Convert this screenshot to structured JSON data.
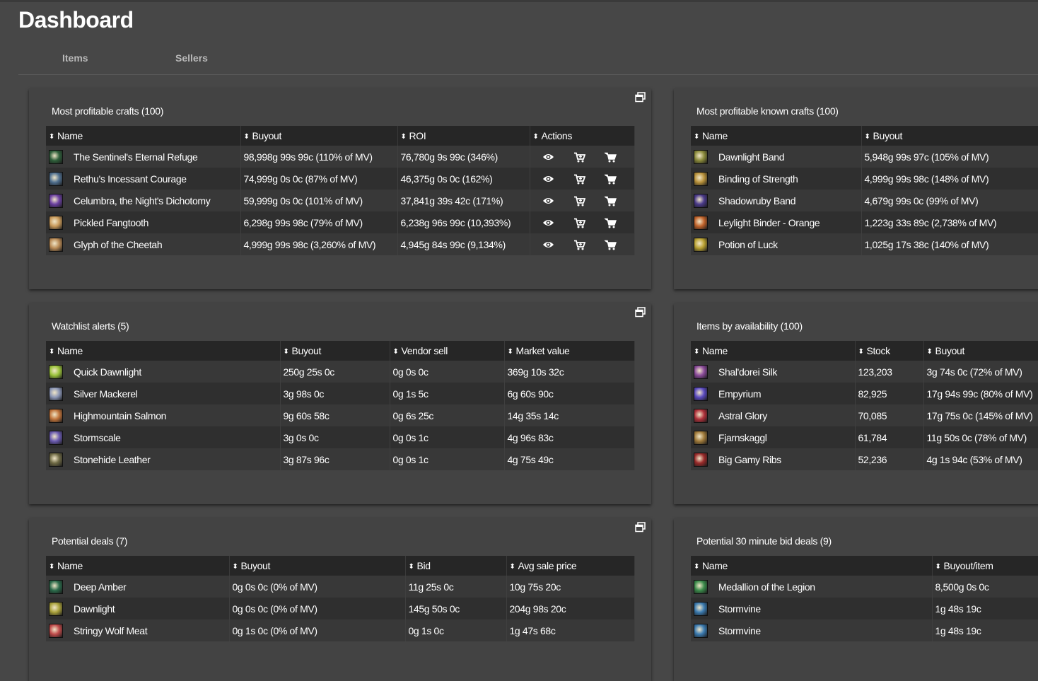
{
  "page": {
    "title": "Dashboard"
  },
  "tabs": [
    {
      "label": "Items"
    },
    {
      "label": "Sellers"
    }
  ],
  "panels": {
    "most_profitable_crafts": {
      "title": "Most profitable crafts (100)",
      "columns": [
        "Name",
        "Buyout",
        "ROI",
        "Actions"
      ],
      "rows": [
        {
          "icon": "sentinel-refuge-icon",
          "color": "#2e5f3a",
          "name": "The Sentinel's Eternal Refuge",
          "buyout": "98,998g 99s 99c (110% of MV)",
          "roi": "76,780g 9s 99c (346%)"
        },
        {
          "icon": "rethu-courage-icon",
          "color": "#4f6f8f",
          "name": "Rethu's Incessant Courage",
          "buyout": "74,999g 0s 0c (87% of MV)",
          "roi": "46,375g 0s 0c (162%)"
        },
        {
          "icon": "celumbra-icon",
          "color": "#6a3fa0",
          "name": "Celumbra, the Night's Dichotomy",
          "buyout": "59,999g 0s 0c (101% of MV)",
          "roi": "37,841g 39s 42c (171%)"
        },
        {
          "icon": "pickled-fangtooth-icon",
          "color": "#c99a5a",
          "name": "Pickled Fangtooth",
          "buyout": "6,298g 99s 98c (79% of MV)",
          "roi": "6,238g 96s 99c (10,393%)"
        },
        {
          "icon": "glyph-cheetah-icon",
          "color": "#b98a55",
          "name": "Glyph of the Cheetah",
          "buyout": "4,999g 99s 98c (3,260% of MV)",
          "roi": "4,945g 84s 99c (9,134%)"
        }
      ]
    },
    "known_crafts": {
      "title": "Most profitable known crafts (100)",
      "columns": [
        "Name",
        "Buyout"
      ],
      "rows": [
        {
          "icon": "dawnlight-band-icon",
          "color": "#8a8a3a",
          "name": "Dawnlight Band",
          "buyout": "5,948g 99s 97c (105% of MV)"
        },
        {
          "icon": "binding-strength-icon",
          "color": "#b8913a",
          "name": "Binding of Strength",
          "buyout": "4,999g 99s 98c (148% of MV)"
        },
        {
          "icon": "shadowruby-band-icon",
          "color": "#4a3a8a",
          "name": "Shadowruby Band",
          "buyout": "4,679g 99s 0c (99% of MV)"
        },
        {
          "icon": "leylight-binder-icon",
          "color": "#c0622a",
          "name": "Leylight Binder - Orange",
          "buyout": "1,223g 33s 89c (2,738% of MV)"
        },
        {
          "icon": "potion-luck-icon",
          "color": "#b8a030",
          "name": "Potion of Luck",
          "buyout": "1,025g 17s 38c (140% of MV)"
        }
      ]
    },
    "watchlist": {
      "title": "Watchlist alerts (5)",
      "columns": [
        "Name",
        "Buyout",
        "Vendor sell",
        "Market value"
      ],
      "rows": [
        {
          "icon": "quick-dawnlight-icon",
          "color": "#9bc33a",
          "name": "Quick Dawnlight",
          "buyout": "250g 25s 0c",
          "vendor": "0g 0s 0c",
          "market": "369g 10s 32c"
        },
        {
          "icon": "silver-mackerel-icon",
          "color": "#8a95b5",
          "name": "Silver Mackerel",
          "buyout": "3g 98s 0c",
          "vendor": "0g 1s 5c",
          "market": "6g 60s 90c"
        },
        {
          "icon": "highmountain-salmon-icon",
          "color": "#c0733a",
          "name": "Highmountain Salmon",
          "buyout": "9g 60s 58c",
          "vendor": "0g 6s 25c",
          "market": "14g 35s 14c"
        },
        {
          "icon": "stormscale-icon",
          "color": "#6a5ab0",
          "name": "Stormscale",
          "buyout": "3g 0s 0c",
          "vendor": "0g 0s 1c",
          "market": "4g 96s 83c"
        },
        {
          "icon": "stonehide-leather-icon",
          "color": "#6f6a45",
          "name": "Stonehide Leather",
          "buyout": "3g 87s 96c",
          "vendor": "0g 0s 1c",
          "market": "4g 75s 49c"
        }
      ]
    },
    "availability": {
      "title": "Items by availability (100)",
      "columns": [
        "Name",
        "Stock",
        "Buyout"
      ],
      "rows": [
        {
          "icon": "shaldorei-silk-icon",
          "color": "#8a4a9a",
          "name": "Shal'dorei Silk",
          "stock": "123,203",
          "buyout": "3g 74s 0c (72% of MV)"
        },
        {
          "icon": "empyrium-icon",
          "color": "#5a4ac0",
          "name": "Empyrium",
          "stock": "82,925",
          "buyout": "17g 94s 99c (80% of MV)"
        },
        {
          "icon": "astral-glory-icon",
          "color": "#b0303a",
          "name": "Astral Glory",
          "stock": "70,085",
          "buyout": "17g 75s 0c (145% of MV)"
        },
        {
          "icon": "fjarnskaggl-icon",
          "color": "#a07a3a",
          "name": "Fjarnskaggl",
          "stock": "61,784",
          "buyout": "11g 50s 0c (78% of MV)"
        },
        {
          "icon": "big-gamy-ribs-icon",
          "color": "#9a2a2a",
          "name": "Big Gamy Ribs",
          "stock": "52,236",
          "buyout": "4g 1s 94c (53% of MV)"
        }
      ]
    },
    "potential_deals": {
      "title": "Potential deals (7)",
      "columns": [
        "Name",
        "Buyout",
        "Bid",
        "Avg sale price"
      ],
      "rows": [
        {
          "icon": "deep-amber-icon",
          "color": "#2a6a4a",
          "name": "Deep Amber",
          "buyout": "0g 0s 0c (0% of MV)",
          "bid": "11g 25s 0c",
          "avg": "10g 75s 20c"
        },
        {
          "icon": "dawnlight-icon",
          "color": "#a8a03a",
          "name": "Dawnlight",
          "buyout": "0g 0s 0c (0% of MV)",
          "bid": "145g 50s 0c",
          "avg": "204g 98s 20c"
        },
        {
          "icon": "stringy-wolf-meat-icon",
          "color": "#c04a4a",
          "name": "Stringy Wolf Meat",
          "buyout": "0g 1s 0c (0% of MV)",
          "bid": "0g 1s 0c",
          "avg": "1g 47s 68c"
        }
      ]
    },
    "bid_deals": {
      "title": "Potential 30 minute bid deals (9)",
      "columns": [
        "Name",
        "Buyout/item"
      ],
      "rows": [
        {
          "icon": "medallion-legion-icon",
          "color": "#3a8a4a",
          "name": "Medallion of the Legion",
          "buyout": "8,500g 0s 0c"
        },
        {
          "icon": "stormvine-icon",
          "color": "#3a7ab0",
          "name": "Stormvine",
          "buyout": "1g 48s 19c"
        },
        {
          "icon": "stormvine-icon",
          "color": "#3a7ab0",
          "name": "Stormvine",
          "buyout": "1g 48s 19c"
        }
      ]
    }
  }
}
